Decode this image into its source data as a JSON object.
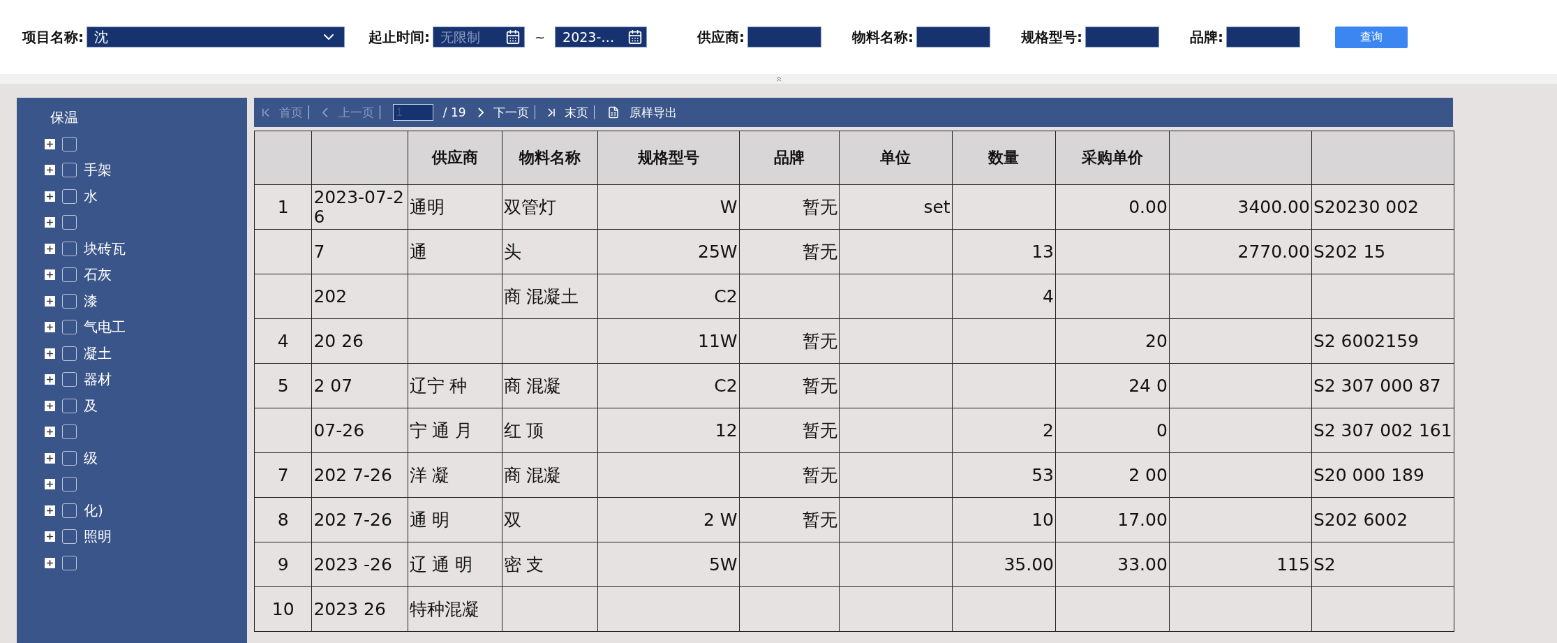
{
  "filters": {
    "project": {
      "label": "项目名称:",
      "value": "沈"
    },
    "period": {
      "label": "起止时间:",
      "from": {
        "placeholder": "无限制"
      },
      "separator": "~",
      "to": {
        "value": "2023-…"
      }
    },
    "fields": [
      {
        "label": "供应商:"
      },
      {
        "label": "物料名称:"
      },
      {
        "label": "规格型号:"
      },
      {
        "label": "品牌:"
      }
    ],
    "search_button": "查询"
  },
  "tree": {
    "root": {
      "label": "保温"
    },
    "items": [
      {
        "checked": false
      },
      {
        "label": "手架",
        "checked": false
      },
      {
        "label": "水",
        "checked": false
      },
      {
        "checked": false
      },
      {
        "label": "块砖瓦",
        "checked": false
      },
      {
        "label": "石灰",
        "checked": false
      },
      {
        "label": "漆",
        "checked": false
      },
      {
        "label": "气电工",
        "checked": false
      },
      {
        "label": "凝土",
        "checked": false
      },
      {
        "label": "器材",
        "checked": false
      },
      {
        "label": "及",
        "checked": false
      },
      {
        "checked": false
      },
      {
        "label": "级",
        "checked": false
      },
      {
        "checked": false
      },
      {
        "label": "化)",
        "checked": false
      },
      {
        "label": "照明",
        "checked": false
      },
      {
        "checked": false
      }
    ]
  },
  "pager": {
    "items": [
      {
        "kind": "first",
        "label": "首页",
        "disabled": true
      },
      {
        "kind": "prev",
        "label": "上一页",
        "disabled": true
      },
      {
        "kind": "page",
        "value": "1",
        "total": "/ 19"
      },
      {
        "kind": "next",
        "label": "下一页",
        "disabled": false
      },
      {
        "kind": "last",
        "label": "末页",
        "disabled": false
      },
      {
        "kind": "export",
        "label": "原样导出",
        "disabled": false
      }
    ]
  },
  "table": {
    "columns": [
      null,
      null,
      "供应商",
      "物料名称",
      "规格型号",
      "品牌",
      "单位",
      "数量",
      "采购单价",
      null,
      null
    ],
    "rows": [
      [
        "1",
        "2023-07-26",
        "通明",
        "双管灯",
        "W",
        "暂无",
        "set",
        null,
        "0.00",
        "3400.00",
        "S20230 002"
      ],
      [
        null,
        "7",
        "通",
        "头",
        "25W",
        "暂无",
        null,
        "13",
        null,
        "2770.00",
        "S202 15"
      ],
      [
        null,
        "202",
        null,
        "商 混凝土",
        "C2",
        null,
        null,
        "4",
        null,
        null,
        null
      ],
      [
        "4",
        "20 26",
        null,
        null,
        "11W",
        "暂无",
        null,
        null,
        "20",
        null,
        "S2 6002159"
      ],
      [
        "5",
        "2 07",
        "辽宁 种",
        "商 混凝",
        "C2",
        "暂无",
        null,
        null,
        "24 0",
        null,
        "S2 307 000 87"
      ],
      [
        null,
        "07-26",
        "宁 通 月",
        "红 顶",
        "12",
        "暂无",
        null,
        "2",
        "0",
        null,
        "S2 307 002 161"
      ],
      [
        "7",
        "202 7-26",
        "洋 凝",
        "商 混凝",
        null,
        "暂无",
        null,
        "53",
        "2 00",
        null,
        "S20 000 189"
      ],
      [
        "8",
        "202 7-26",
        "通 明",
        "双",
        "2 W",
        "暂无",
        null,
        "10",
        "17.00",
        null,
        "S202 6002"
      ],
      [
        "9",
        "2023 -26",
        "辽 通 明",
        "密 支",
        "5W",
        null,
        null,
        "35.00",
        "33.00",
        "115",
        "S2"
      ],
      [
        "10",
        "2023 26",
        "特种混凝",
        null,
        null,
        null,
        null,
        null,
        null,
        null,
        null
      ]
    ]
  }
}
